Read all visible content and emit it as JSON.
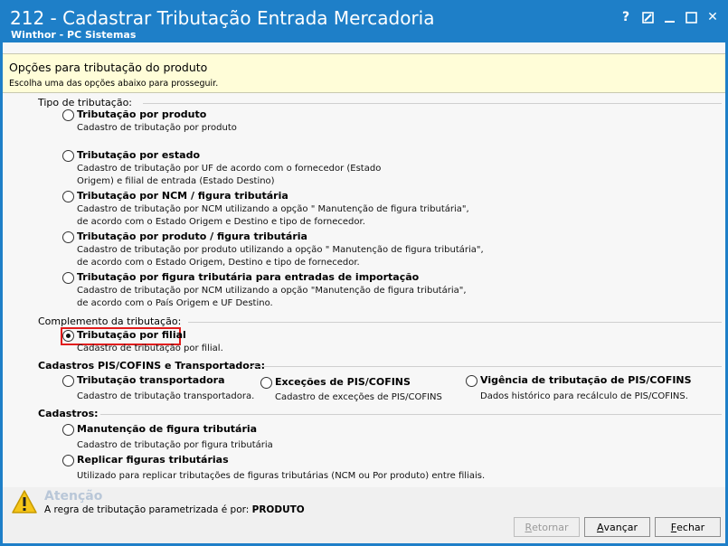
{
  "window": {
    "title": "212 - Cadastrar Tributação Entrada Mercadoria",
    "subtitle": "Winthor - PC Sistemas",
    "controls": [
      "help-icon",
      "edit-icon",
      "minimize-icon",
      "maximize-icon",
      "close-icon"
    ],
    "help_glyph": "?",
    "close_glyph": "✕",
    "accent_color": "#1e7fc8"
  },
  "header": {
    "title": "Opções para tributação do produto",
    "subtitle": "Escolha uma das opções abaixo para prosseguir."
  },
  "groups": {
    "tipo": "Tipo de tributação:",
    "complemento": "Complemento da tributação:",
    "pis": "Cadastros PIS/COFINS e Transportadora:",
    "cadastros": "Cadastros:"
  },
  "options": {
    "produto": {
      "label": "Tributação por produto",
      "desc": "Cadastro de tributação por produto"
    },
    "estado": {
      "label": "Tributação por estado",
      "desc": "Cadastro de tributação por UF de acordo com o fornecedor (Estado\nOrigem) e filial de entrada (Estado Destino)"
    },
    "ncm": {
      "label": "Tributação por NCM / figura tributária",
      "desc": "Cadastro de tributação por NCM utilizando a opção \" Manutenção de figura tributária\",\nde acordo com o Estado Origem e Destino e tipo de fornecedor."
    },
    "produto_figura": {
      "label": "Tributação por produto / figura tributária",
      "desc": "Cadastro de tributação por produto utilizando a opção \" Manutenção de figura tributária\",\nde acordo com o Estado Origem, Destino e tipo de fornecedor."
    },
    "importacao": {
      "label": "Tributação por figura tributária para entradas de importação",
      "desc": "Cadastro de tributação por NCM utilizando a opção \"Manutenção de figura tributária\",\nde acordo com o País Origem e UF Destino."
    },
    "filial": {
      "label": "Tributação por filial",
      "desc": "Cadastro de tributação por filial.",
      "checked": true
    },
    "transportadora": {
      "label": "Tributação  transportadora",
      "desc": "Cadastro de tributação transportadora."
    },
    "excecoes": {
      "label": "Exceções de PIS/COFINS",
      "desc": "Cadastro de exceções de PIS/COFINS"
    },
    "vigencia": {
      "label": "Vigência de tributação de PIS/COFINS",
      "desc": "Dados histórico para recálculo de PIS/COFINS."
    },
    "manutencao": {
      "label": "Manutenção de figura tributária",
      "desc": "Cadastro de tributação por figura tributária"
    },
    "replicar": {
      "label": "Replicar figuras tributárias",
      "desc": "Utilizado para replicar tributações de figuras tributárias (NCM ou Por produto) entre filiais."
    }
  },
  "footer": {
    "warn_title": "Atenção",
    "warn_text": "A regra de tributação parametrizada é por:",
    "warn_value": "PRODUTO",
    "warn_icon": "warning-icon",
    "buttons": {
      "back": {
        "first": "R",
        "rest": "etornar",
        "disabled": true
      },
      "next": {
        "first": "A",
        "rest": "vançar"
      },
      "close": {
        "first": "F",
        "rest": "echar"
      }
    }
  }
}
